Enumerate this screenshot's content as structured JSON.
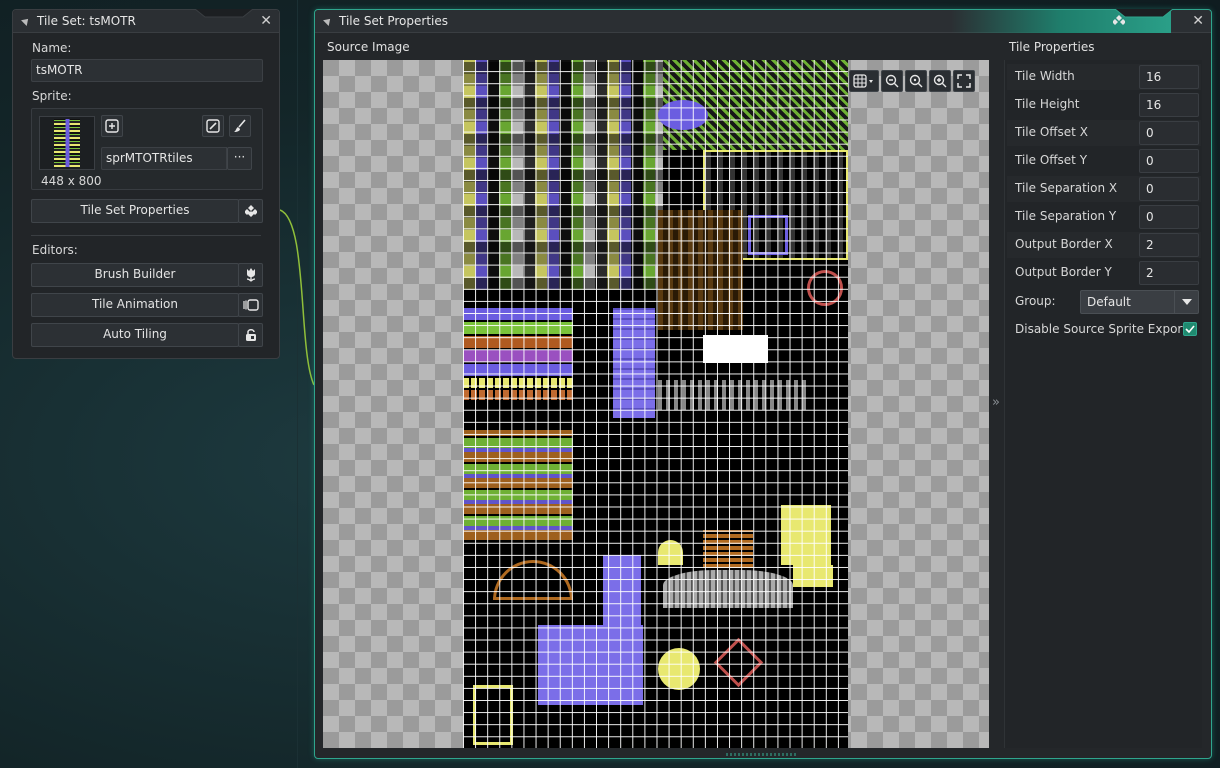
{
  "left_window": {
    "title": "Tile Set: tsMOTR",
    "close_glyph": "✕",
    "name_label": "Name:",
    "name_value": "tsMOTR",
    "sprite_label": "Sprite:",
    "sprite_name": "sprMTOTRtiles",
    "sprite_more": "···",
    "sprite_size": "448 x 800",
    "tile_set_properties_button": "Tile Set Properties",
    "editors_label": "Editors:",
    "editors": [
      {
        "label": "Brush Builder",
        "icon": "tulip-icon"
      },
      {
        "label": "Tile Animation",
        "icon": "animation-icon"
      },
      {
        "label": "Auto Tiling",
        "icon": "lock-icon"
      }
    ]
  },
  "main_window": {
    "title": "Tile Set Properties",
    "close_glyph": "✕",
    "source_image_label": "Source Image",
    "tile_properties_label": "Tile Properties",
    "properties": [
      {
        "label": "Tile Width",
        "value": "16"
      },
      {
        "label": "Tile Height",
        "value": "16"
      },
      {
        "label": "Tile Offset X",
        "value": "0"
      },
      {
        "label": "Tile Offset Y",
        "value": "0"
      },
      {
        "label": "Tile Separation X",
        "value": "0"
      },
      {
        "label": "Tile Separation Y",
        "value": "0"
      },
      {
        "label": "Output Border X",
        "value": "2"
      },
      {
        "label": "Output Border Y",
        "value": "2"
      }
    ],
    "group_label": "Group:",
    "group_value": "Default",
    "disable_export_label": "Disable Source Sprite Export",
    "disable_export_checked": true,
    "collapse_glyph": "»"
  },
  "colors": {
    "accent": "#2fa58d",
    "panel_bg": "#222528",
    "tile_yellow": "#e8e870",
    "tile_purple": "#7b6ee8",
    "tile_green": "#7ac33a"
  }
}
